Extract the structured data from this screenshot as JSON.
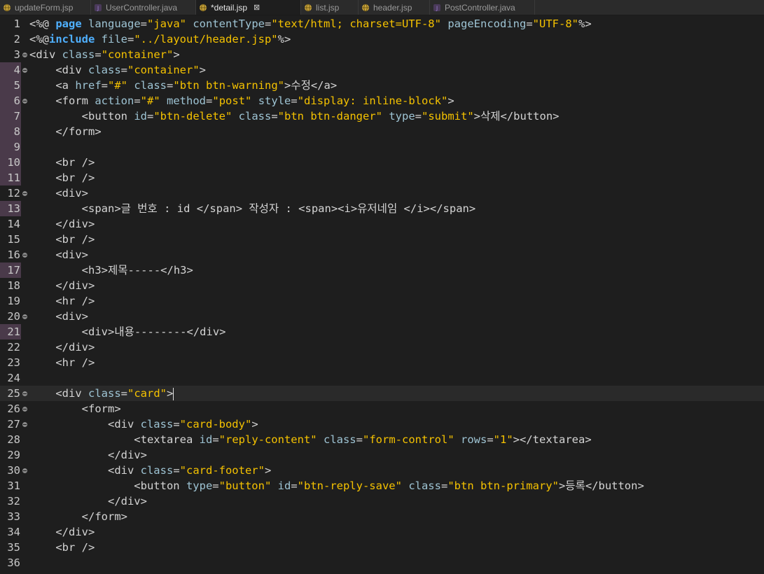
{
  "tabs": [
    {
      "label": "updateForm.jsp",
      "icon": "globe-icon",
      "active": false,
      "dirty": false
    },
    {
      "label": "UserController.java",
      "icon": "java-file-icon",
      "active": false,
      "dirty": false
    },
    {
      "label": "*detail.jsp",
      "icon": "globe-icon",
      "active": true,
      "dirty": true
    },
    {
      "label": "list.jsp",
      "icon": "globe-icon",
      "active": false,
      "dirty": false
    },
    {
      "label": "header.jsp",
      "icon": "globe-icon",
      "active": false,
      "dirty": false
    },
    {
      "label": "PostController.java",
      "icon": "java-file-icon",
      "active": false,
      "dirty": false
    }
  ],
  "close_glyph": "⊠",
  "colors": {
    "background": "#1e1e1e",
    "string": "#f5c200",
    "keyword": "#4fb0ff",
    "change_marker": "#523f52"
  },
  "current_line": 25,
  "lines": [
    {
      "n": "1",
      "fold": false,
      "mark": false,
      "segs": [
        [
          "p",
          "<%@ "
        ],
        [
          "kw",
          "page"
        ],
        [
          "p",
          " "
        ],
        [
          "a",
          "language"
        ],
        [
          "p",
          "="
        ],
        [
          "s",
          "\"java\""
        ],
        [
          "p",
          " "
        ],
        [
          "a",
          "contentType"
        ],
        [
          "p",
          "="
        ],
        [
          "s",
          "\"text/html; charset=UTF-8\""
        ],
        [
          "p",
          " "
        ],
        [
          "a",
          "pageEncoding"
        ],
        [
          "p",
          "="
        ],
        [
          "s",
          "\"UTF-8\""
        ],
        [
          "p",
          "%>"
        ]
      ]
    },
    {
      "n": "2",
      "fold": false,
      "mark": false,
      "segs": [
        [
          "p",
          "<%@"
        ],
        [
          "kw",
          "include"
        ],
        [
          "p",
          " "
        ],
        [
          "a",
          "file"
        ],
        [
          "p",
          "="
        ],
        [
          "s",
          "\"../layout/header.jsp\""
        ],
        [
          "p",
          "%>"
        ]
      ]
    },
    {
      "n": "3",
      "fold": true,
      "mark": false,
      "segs": [
        [
          "p",
          "<div "
        ],
        [
          "a",
          "class"
        ],
        [
          "p",
          "="
        ],
        [
          "s",
          "\"container\""
        ],
        [
          "p",
          ">"
        ]
      ]
    },
    {
      "n": "4",
      "fold": true,
      "mark": true,
      "segs": [
        [
          "p",
          "    <div "
        ],
        [
          "a",
          "class"
        ],
        [
          "p",
          "="
        ],
        [
          "s",
          "\"container\""
        ],
        [
          "p",
          ">"
        ]
      ]
    },
    {
      "n": "5",
      "fold": false,
      "mark": true,
      "segs": [
        [
          "p",
          "    <a "
        ],
        [
          "a",
          "href"
        ],
        [
          "p",
          "="
        ],
        [
          "s",
          "\"#\""
        ],
        [
          "p",
          " "
        ],
        [
          "a",
          "class"
        ],
        [
          "p",
          "="
        ],
        [
          "s",
          "\"btn btn-warning\""
        ],
        [
          "p",
          ">수정</a>"
        ]
      ]
    },
    {
      "n": "6",
      "fold": true,
      "mark": true,
      "segs": [
        [
          "p",
          "    <form "
        ],
        [
          "a",
          "action"
        ],
        [
          "p",
          "="
        ],
        [
          "s",
          "\"#\""
        ],
        [
          "p",
          " "
        ],
        [
          "a",
          "method"
        ],
        [
          "p",
          "="
        ],
        [
          "s",
          "\"post\""
        ],
        [
          "p",
          " "
        ],
        [
          "a",
          "style"
        ],
        [
          "p",
          "="
        ],
        [
          "s",
          "\"display: inline-block\""
        ],
        [
          "p",
          ">"
        ]
      ]
    },
    {
      "n": "7",
      "fold": false,
      "mark": true,
      "segs": [
        [
          "p",
          "        <button "
        ],
        [
          "a",
          "id"
        ],
        [
          "p",
          "="
        ],
        [
          "s",
          "\"btn-delete\""
        ],
        [
          "p",
          " "
        ],
        [
          "a",
          "class"
        ],
        [
          "p",
          "="
        ],
        [
          "s",
          "\"btn btn-danger\""
        ],
        [
          "p",
          " "
        ],
        [
          "a",
          "type"
        ],
        [
          "p",
          "="
        ],
        [
          "s",
          "\"submit\""
        ],
        [
          "p",
          ">삭제</button>"
        ]
      ]
    },
    {
      "n": "8",
      "fold": false,
      "mark": true,
      "segs": [
        [
          "p",
          "    </form>"
        ]
      ]
    },
    {
      "n": "9",
      "fold": false,
      "mark": true,
      "segs": [
        [
          "p",
          ""
        ]
      ]
    },
    {
      "n": "10",
      "fold": false,
      "mark": true,
      "segs": [
        [
          "p",
          "    <br />"
        ]
      ]
    },
    {
      "n": "11",
      "fold": false,
      "mark": true,
      "segs": [
        [
          "p",
          "    <br />"
        ]
      ]
    },
    {
      "n": "12",
      "fold": true,
      "mark": false,
      "segs": [
        [
          "p",
          "    <div>"
        ]
      ]
    },
    {
      "n": "13",
      "fold": false,
      "mark": true,
      "segs": [
        [
          "p",
          "        <span>글 번호 : id </span> 작성자 : <span><i>유저네임 </i></span>"
        ]
      ]
    },
    {
      "n": "14",
      "fold": false,
      "mark": false,
      "segs": [
        [
          "p",
          "    </div>"
        ]
      ]
    },
    {
      "n": "15",
      "fold": false,
      "mark": false,
      "segs": [
        [
          "p",
          "    <br />"
        ]
      ]
    },
    {
      "n": "16",
      "fold": true,
      "mark": false,
      "segs": [
        [
          "p",
          "    <div>"
        ]
      ]
    },
    {
      "n": "17",
      "fold": false,
      "mark": true,
      "segs": [
        [
          "p",
          "        <h3>제목-----</h3>"
        ]
      ]
    },
    {
      "n": "18",
      "fold": false,
      "mark": false,
      "segs": [
        [
          "p",
          "    </div>"
        ]
      ]
    },
    {
      "n": "19",
      "fold": false,
      "mark": false,
      "segs": [
        [
          "p",
          "    <hr />"
        ]
      ]
    },
    {
      "n": "20",
      "fold": true,
      "mark": false,
      "segs": [
        [
          "p",
          "    <div>"
        ]
      ]
    },
    {
      "n": "21",
      "fold": false,
      "mark": true,
      "segs": [
        [
          "p",
          "        <div>내용--------</div>"
        ]
      ]
    },
    {
      "n": "22",
      "fold": false,
      "mark": false,
      "segs": [
        [
          "p",
          "    </div>"
        ]
      ]
    },
    {
      "n": "23",
      "fold": false,
      "mark": false,
      "segs": [
        [
          "p",
          "    <hr />"
        ]
      ]
    },
    {
      "n": "24",
      "fold": false,
      "mark": false,
      "segs": [
        [
          "p",
          ""
        ]
      ]
    },
    {
      "n": "25",
      "fold": true,
      "mark": false,
      "segs": [
        [
          "p",
          "    <div "
        ],
        [
          "a",
          "class"
        ],
        [
          "p",
          "="
        ],
        [
          "s",
          "\"card\""
        ],
        [
          "p",
          ">"
        ]
      ]
    },
    {
      "n": "26",
      "fold": true,
      "mark": false,
      "segs": [
        [
          "p",
          "        <form>"
        ]
      ]
    },
    {
      "n": "27",
      "fold": true,
      "mark": false,
      "segs": [
        [
          "p",
          "            <div "
        ],
        [
          "a",
          "class"
        ],
        [
          "p",
          "="
        ],
        [
          "s",
          "\"card-body\""
        ],
        [
          "p",
          ">"
        ]
      ]
    },
    {
      "n": "28",
      "fold": false,
      "mark": false,
      "segs": [
        [
          "p",
          "                <textarea "
        ],
        [
          "a",
          "id"
        ],
        [
          "p",
          "="
        ],
        [
          "s",
          "\"reply-content\""
        ],
        [
          "p",
          " "
        ],
        [
          "a",
          "class"
        ],
        [
          "p",
          "="
        ],
        [
          "s",
          "\"form-control\""
        ],
        [
          "p",
          " "
        ],
        [
          "a",
          "rows"
        ],
        [
          "p",
          "="
        ],
        [
          "s",
          "\"1\""
        ],
        [
          "p",
          "></textarea>"
        ]
      ]
    },
    {
      "n": "29",
      "fold": false,
      "mark": false,
      "segs": [
        [
          "p",
          "            </div>"
        ]
      ]
    },
    {
      "n": "30",
      "fold": true,
      "mark": false,
      "segs": [
        [
          "p",
          "            <div "
        ],
        [
          "a",
          "class"
        ],
        [
          "p",
          "="
        ],
        [
          "s",
          "\"card-footer\""
        ],
        [
          "p",
          ">"
        ]
      ]
    },
    {
      "n": "31",
      "fold": false,
      "mark": false,
      "segs": [
        [
          "p",
          "                <button "
        ],
        [
          "a",
          "type"
        ],
        [
          "p",
          "="
        ],
        [
          "s",
          "\"button\""
        ],
        [
          "p",
          " "
        ],
        [
          "a",
          "id"
        ],
        [
          "p",
          "="
        ],
        [
          "s",
          "\"btn-reply-save\""
        ],
        [
          "p",
          " "
        ],
        [
          "a",
          "class"
        ],
        [
          "p",
          "="
        ],
        [
          "s",
          "\"btn btn-primary\""
        ],
        [
          "p",
          ">등록</button>"
        ]
      ]
    },
    {
      "n": "32",
      "fold": false,
      "mark": false,
      "segs": [
        [
          "p",
          "            </div>"
        ]
      ]
    },
    {
      "n": "33",
      "fold": false,
      "mark": false,
      "segs": [
        [
          "p",
          "        </form>"
        ]
      ]
    },
    {
      "n": "34",
      "fold": false,
      "mark": false,
      "segs": [
        [
          "p",
          "    </div>"
        ]
      ]
    },
    {
      "n": "35",
      "fold": false,
      "mark": false,
      "segs": [
        [
          "p",
          "    <br />"
        ]
      ]
    },
    {
      "n": "36",
      "fold": false,
      "mark": false,
      "segs": [
        [
          "p",
          ""
        ]
      ]
    }
  ]
}
